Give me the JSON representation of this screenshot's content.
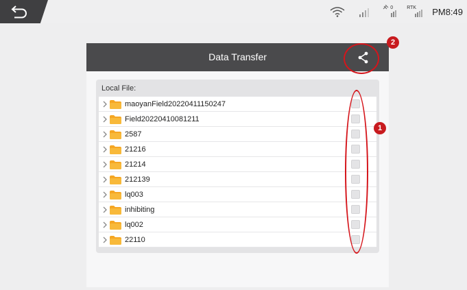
{
  "status_bar": {
    "time": "PM8:49",
    "rtk_label": "RTK",
    "sat_count": "0",
    "icons": [
      "back-icon",
      "wifi-icon",
      "cellular-signal-icon",
      "satellite-icon",
      "rtk-signal-icon"
    ]
  },
  "dialog": {
    "title": "Data Transfer",
    "share_icon": "share-icon"
  },
  "local_files": {
    "label": "Local File:",
    "items": [
      {
        "name": "maoyanField20220411150247",
        "checked": false
      },
      {
        "name": "Field20220410081211",
        "checked": false
      },
      {
        "name": "2587",
        "checked": false
      },
      {
        "name": "21216",
        "checked": false
      },
      {
        "name": "21214",
        "checked": false
      },
      {
        "name": "212139",
        "checked": false
      },
      {
        "name": "lq003",
        "checked": false
      },
      {
        "name": "inhibiting",
        "checked": false
      },
      {
        "name": "lq002",
        "checked": false
      },
      {
        "name": "22110",
        "checked": false
      }
    ]
  },
  "annotations": {
    "badge_1": "1",
    "badge_2": "2",
    "color": "#d5151b"
  },
  "colors": {
    "header_bg": "#4a4a4c",
    "folder": "#f5a623",
    "background": "#eeeeef"
  }
}
